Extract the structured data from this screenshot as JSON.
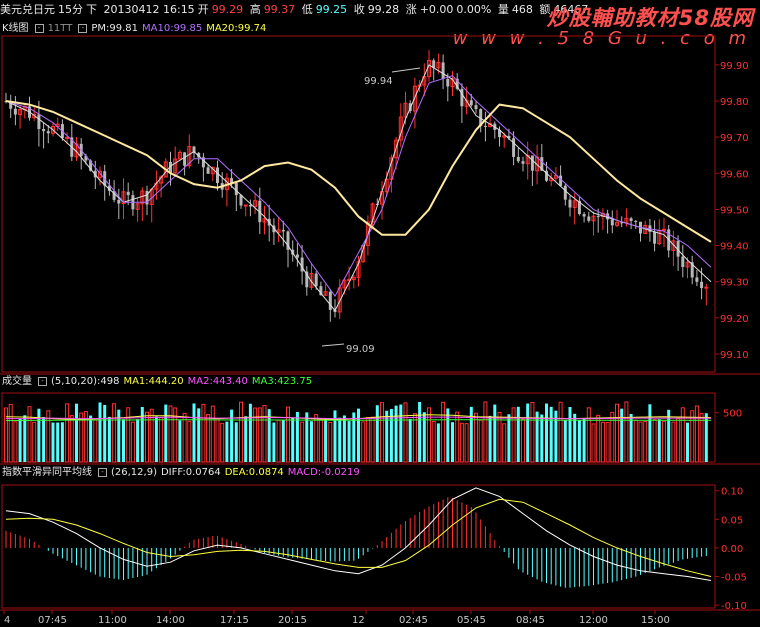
{
  "header": {
    "pair": "美元兑日元",
    "period": "15分",
    "direction": "下",
    "datetime": "20130412 16:15",
    "open_label": "开",
    "open": "99.29",
    "high_label": "高",
    "high": "99.37",
    "low_label": "低",
    "low": "99.25",
    "close_label": "收",
    "close": "99.28",
    "change_label": "涨",
    "change": "+0.00",
    "change_pct": "0.00%",
    "volume_label": "量",
    "volume": "468",
    "amount_label": "额",
    "amount": "46467"
  },
  "watermark": {
    "title": "炒股輔助教材58股网",
    "url": "w w w . 5 8 G u . c o m"
  },
  "kline_legend": {
    "name": "K线图",
    "indicator": "11TT",
    "pm_label": "PM:",
    "pm": "99.81",
    "ma10_label": "MA10:",
    "ma10": "99.85",
    "ma20_label": "MA20:",
    "ma20": "99.74"
  },
  "volume_legend": {
    "name": "成交量",
    "params": "(5,10,20)",
    "value": ":498",
    "ma1_label": "MA1:",
    "ma1": "444.20",
    "ma2_label": "MA2:",
    "ma2": "443.40",
    "ma3_label": "MA3:",
    "ma3": "423.75"
  },
  "macd_legend": {
    "name": "指数平滑异同平均线",
    "params": "(26,12,9)",
    "diff_label": "DIFF:",
    "diff": "0.0764",
    "dea_label": "DEA:",
    "dea": "0.0874",
    "macd_label": "MACD:",
    "macd": "-0.0219"
  },
  "colors": {
    "up": "#ff3030",
    "down": "#54ffff",
    "kline_down": "#b8b8b8",
    "ma20": "#ffe8a0",
    "ma10": "#b070ff",
    "pm": "#e0e0e0",
    "frame": "#a01010"
  },
  "chart_data": [
    {
      "type": "candlestick",
      "panel": "kline",
      "y_ticks": [
        "99.90",
        "99.80",
        "99.70",
        "99.60",
        "99.50",
        "99.40",
        "99.30",
        "99.20",
        "99.10"
      ],
      "ylim": [
        99.05,
        99.98
      ],
      "annotations": [
        {
          "text": "99.94",
          "kind": "high"
        },
        {
          "text": "99.09",
          "kind": "low"
        }
      ],
      "x_ticks": [
        "4",
        "07:45",
        "11:00",
        "14:00",
        "17:15",
        "20:15",
        "12",
        "02:45",
        "05:45",
        "08:45",
        "12:00",
        "15:00"
      ],
      "series": [
        {
          "name": "MA20",
          "values": [
            99.8,
            99.79,
            99.77,
            99.74,
            99.71,
            99.68,
            99.65,
            99.6,
            99.57,
            99.56,
            99.58,
            99.62,
            99.63,
            99.61,
            99.56,
            99.48,
            99.43,
            99.43,
            99.5,
            99.62,
            99.72,
            99.79,
            99.78,
            99.74,
            99.7,
            99.64,
            99.58,
            99.53,
            99.49,
            99.45,
            99.41
          ]
        },
        {
          "name": "MA10",
          "values": [
            99.8,
            99.78,
            99.74,
            99.68,
            99.6,
            99.52,
            99.52,
            99.58,
            99.64,
            99.64,
            99.58,
            99.52,
            99.45,
            99.35,
            99.26,
            99.38,
            99.5,
            99.7,
            99.85,
            99.87,
            99.8,
            99.74,
            99.68,
            99.62,
            99.56,
            99.5,
            99.47,
            99.45,
            99.44,
            99.4,
            99.34
          ]
        },
        {
          "name": "PM",
          "values": [
            99.8,
            99.77,
            99.72,
            99.66,
            99.58,
            99.52,
            99.54,
            99.62,
            99.66,
            99.6,
            99.54,
            99.48,
            99.4,
            99.3,
            99.22,
            99.35,
            99.55,
            99.75,
            99.9,
            99.86,
            99.76,
            99.72,
            99.66,
            99.6,
            99.54,
            99.49,
            99.47,
            99.45,
            99.43,
            99.36,
            99.3
          ]
        }
      ]
    },
    {
      "type": "bar",
      "panel": "volume",
      "y_ticks": [
        "500"
      ],
      "ylim": [
        0,
        700
      ],
      "series": [
        {
          "name": "MA1",
          "values": [
            460,
            455,
            440,
            430,
            440,
            450,
            470,
            470,
            450,
            440,
            450,
            460,
            450,
            440,
            430,
            440,
            460,
            470,
            480,
            475,
            460,
            455,
            450,
            445,
            440,
            445,
            450,
            455,
            460,
            455,
            450
          ]
        },
        {
          "name": "MA2",
          "values": [
            440,
            440,
            445,
            440,
            440,
            445,
            450,
            455,
            450,
            445,
            445,
            450,
            450,
            445,
            440,
            440,
            445,
            450,
            455,
            455,
            450,
            445,
            445,
            440,
            440,
            440,
            442,
            445,
            445,
            445,
            443
          ]
        },
        {
          "name": "MA3",
          "values": [
            420,
            422,
            424,
            425,
            426,
            426,
            427,
            428,
            428,
            427,
            426,
            426,
            426,
            425,
            424,
            424,
            425,
            426,
            427,
            428,
            428,
            427,
            426,
            425,
            424,
            424,
            424,
            424,
            424,
            424,
            424
          ]
        }
      ]
    },
    {
      "type": "bar",
      "panel": "macd",
      "y_ticks": [
        "0.10",
        "0.05",
        "0.00",
        "-0.05",
        "-0.10"
      ],
      "ylim": [
        -0.105,
        0.11
      ],
      "series": [
        {
          "name": "DIFF",
          "values": [
            0.065,
            0.06,
            0.045,
            0.025,
            0.0,
            -0.02,
            -0.032,
            -0.025,
            -0.005,
            0.005,
            0.0,
            -0.01,
            -0.02,
            -0.03,
            -0.04,
            -0.045,
            -0.03,
            0.0,
            0.04,
            0.085,
            0.105,
            0.09,
            0.06,
            0.03,
            0.005,
            -0.015,
            -0.03,
            -0.04,
            -0.045,
            -0.05,
            -0.057
          ]
        },
        {
          "name": "DEA",
          "values": [
            0.05,
            0.052,
            0.05,
            0.04,
            0.025,
            0.008,
            -0.008,
            -0.015,
            -0.012,
            -0.006,
            -0.004,
            -0.006,
            -0.012,
            -0.02,
            -0.028,
            -0.034,
            -0.034,
            -0.022,
            0.005,
            0.04,
            0.07,
            0.085,
            0.08,
            0.06,
            0.04,
            0.018,
            0.0,
            -0.015,
            -0.028,
            -0.04,
            -0.05
          ]
        }
      ]
    }
  ]
}
